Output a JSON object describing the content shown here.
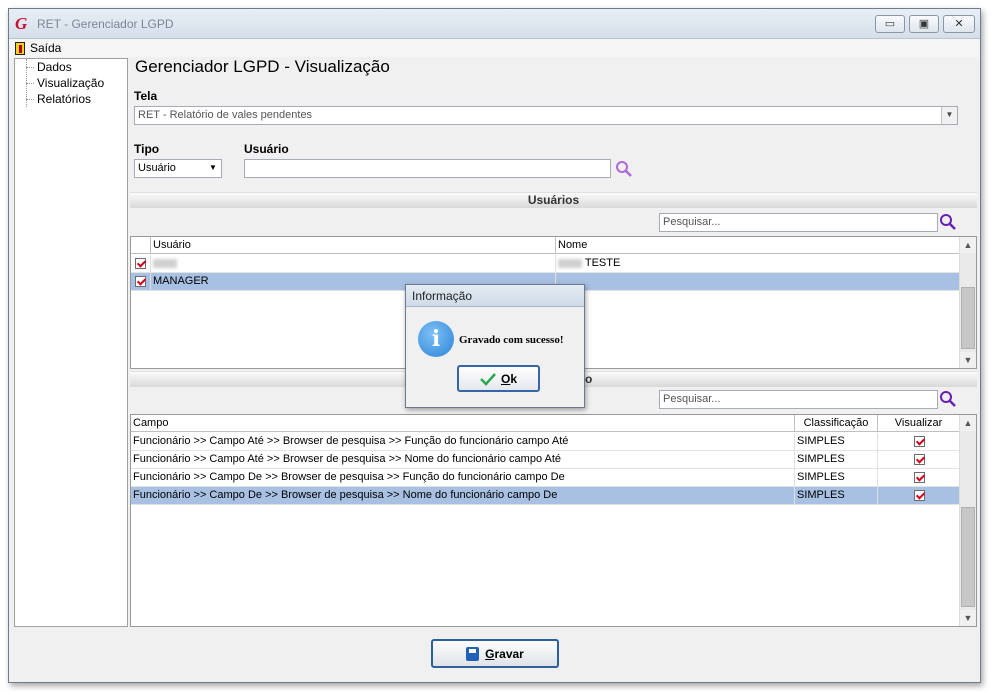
{
  "window": {
    "title": "RET - Gerenciador LGPD",
    "controls": {
      "minimize": "▭",
      "maximize": "▣",
      "close": "✕"
    }
  },
  "menu": {
    "exit_label": "Saída"
  },
  "nav": {
    "items": [
      "Dados",
      "Visualização",
      "Relatórios"
    ]
  },
  "main": {
    "title": "Gerenciador LGPD - Visualização",
    "tela": {
      "label": "Tela",
      "value": "RET - Relatório de vales pendentes"
    },
    "tipo": {
      "label": "Tipo",
      "value": "Usuário"
    },
    "usuario": {
      "label": "Usuário",
      "value": ""
    }
  },
  "users_section": {
    "title": "Usuários",
    "search_placeholder": "Pesquisar...",
    "columns": [
      "Usuário",
      "Nome"
    ],
    "rows": [
      {
        "checked": true,
        "usuario": "",
        "nome": "TESTE",
        "selected": false
      },
      {
        "checked": true,
        "usuario": "MANAGER",
        "nome": "",
        "selected": true
      }
    ]
  },
  "fields_section": {
    "title": "o",
    "search_placeholder": "Pesquisar...",
    "columns": [
      "Campo",
      "Classificação",
      "Visualizar"
    ],
    "rows": [
      {
        "campo": "Funcionário >> Campo Até >> Browser de pesquisa >> Função do funcionário campo Até",
        "classificacao": "SIMPLES",
        "visualizar": true,
        "selected": false
      },
      {
        "campo": "Funcionário >> Campo Até >> Browser de pesquisa >> Nome do funcionário campo Até",
        "classificacao": "SIMPLES",
        "visualizar": true,
        "selected": false
      },
      {
        "campo": "Funcionário >> Campo De >> Browser de pesquisa >> Função do funcionário campo De",
        "classificacao": "SIMPLES",
        "visualizar": true,
        "selected": false
      },
      {
        "campo": "Funcionário >> Campo De >> Browser de pesquisa >> Nome do funcionário campo De",
        "classificacao": "SIMPLES",
        "visualizar": true,
        "selected": true
      }
    ]
  },
  "buttons": {
    "save": "Gravar",
    "save_mnemonic": "G",
    "save_rest": "ravar"
  },
  "dialog": {
    "title": "Informação",
    "message": "Gravado com sucesso!",
    "ok_mnemonic": "O",
    "ok_rest": "k",
    "icon": "info-icon"
  },
  "colors": {
    "selection": "#a8c0e2",
    "check": "#d0021b",
    "button_border": "#2d5f99"
  }
}
